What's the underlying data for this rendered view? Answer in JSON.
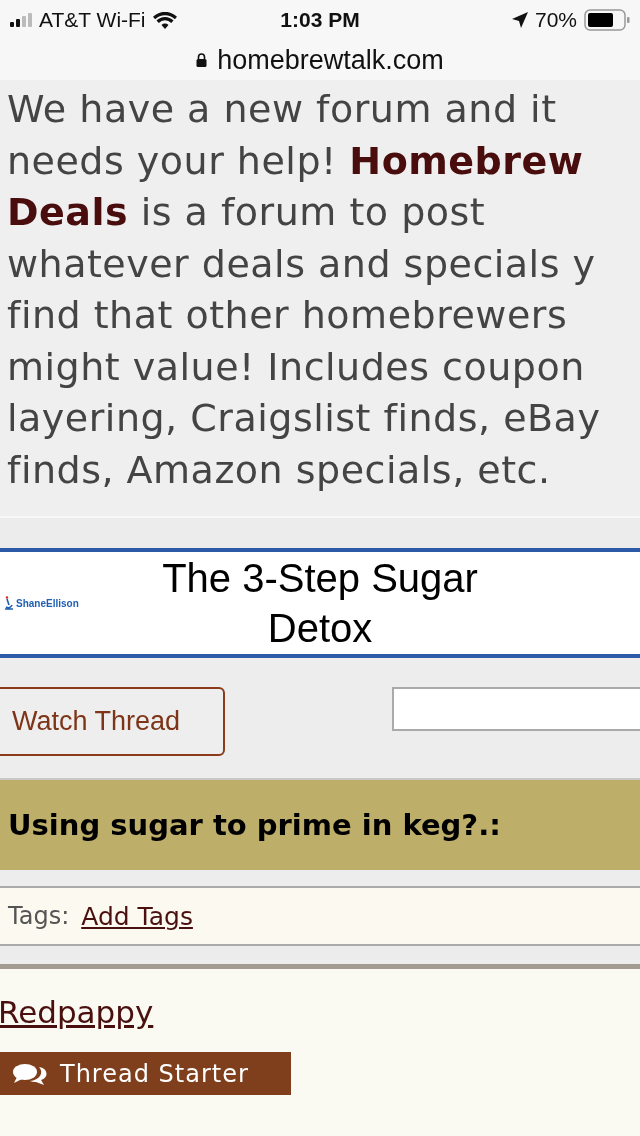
{
  "status_bar": {
    "carrier": "AT&T Wi-Fi",
    "time": "1:03 PM",
    "battery": "70%"
  },
  "url_bar": {
    "domain": "homebrewtalk.com"
  },
  "notice": {
    "lines": [
      "We have a new forum and it",
      "needs your help! **Homebrew**",
      "**Deals** is a forum to post",
      "whatever deals and specials y",
      "find that other homebrewers",
      "might value! Includes coupon",
      "layering, Craigslist finds, eBay",
      "finds, Amazon specials, etc."
    ]
  },
  "ad": {
    "brand": "ShaneEllison",
    "headline": "The 3-Step Sugar Detox"
  },
  "watch_button": "Watch Thread",
  "thread_title": "Using sugar to prime in keg?.:",
  "tags": {
    "label": "Tags:",
    "link": "Add Tags"
  },
  "post": {
    "author": "Redpappy",
    "badge": "Thread Starter"
  }
}
